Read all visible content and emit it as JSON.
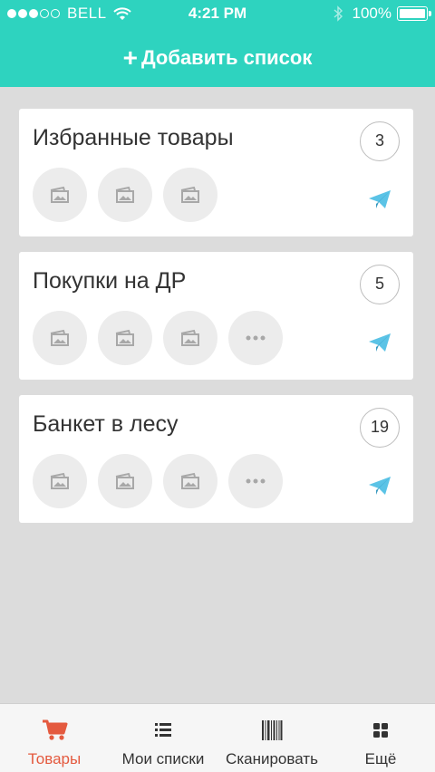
{
  "status_bar": {
    "carrier": "BELL",
    "time": "4:21 PM",
    "battery": "100%"
  },
  "header": {
    "add_list_plus": "+",
    "add_list_label": "Добавить список"
  },
  "lists": [
    {
      "title": "Избранные товары",
      "count": "3",
      "thumbnails": [
        "image-icon",
        "image-icon",
        "image-icon"
      ],
      "has_more": false
    },
    {
      "title": "Покупки на ДР",
      "count": "5",
      "thumbnails": [
        "image-icon",
        "image-icon",
        "image-icon"
      ],
      "has_more": true
    },
    {
      "title": "Банкет в лесу",
      "count": "19",
      "thumbnails": [
        "image-icon",
        "image-icon",
        "image-icon"
      ],
      "has_more": true
    }
  ],
  "tabs": [
    {
      "label": "Товары",
      "icon": "cart-icon",
      "active": true
    },
    {
      "label": "Мои списки",
      "icon": "list-icon",
      "active": false
    },
    {
      "label": "Сканировать",
      "icon": "barcode-icon",
      "active": false
    },
    {
      "label": "Ещё",
      "icon": "grid-icon",
      "active": false
    }
  ],
  "colors": {
    "header": "#2ed3bf",
    "accent": "#e45a3f",
    "send": "#5bc3e6"
  }
}
